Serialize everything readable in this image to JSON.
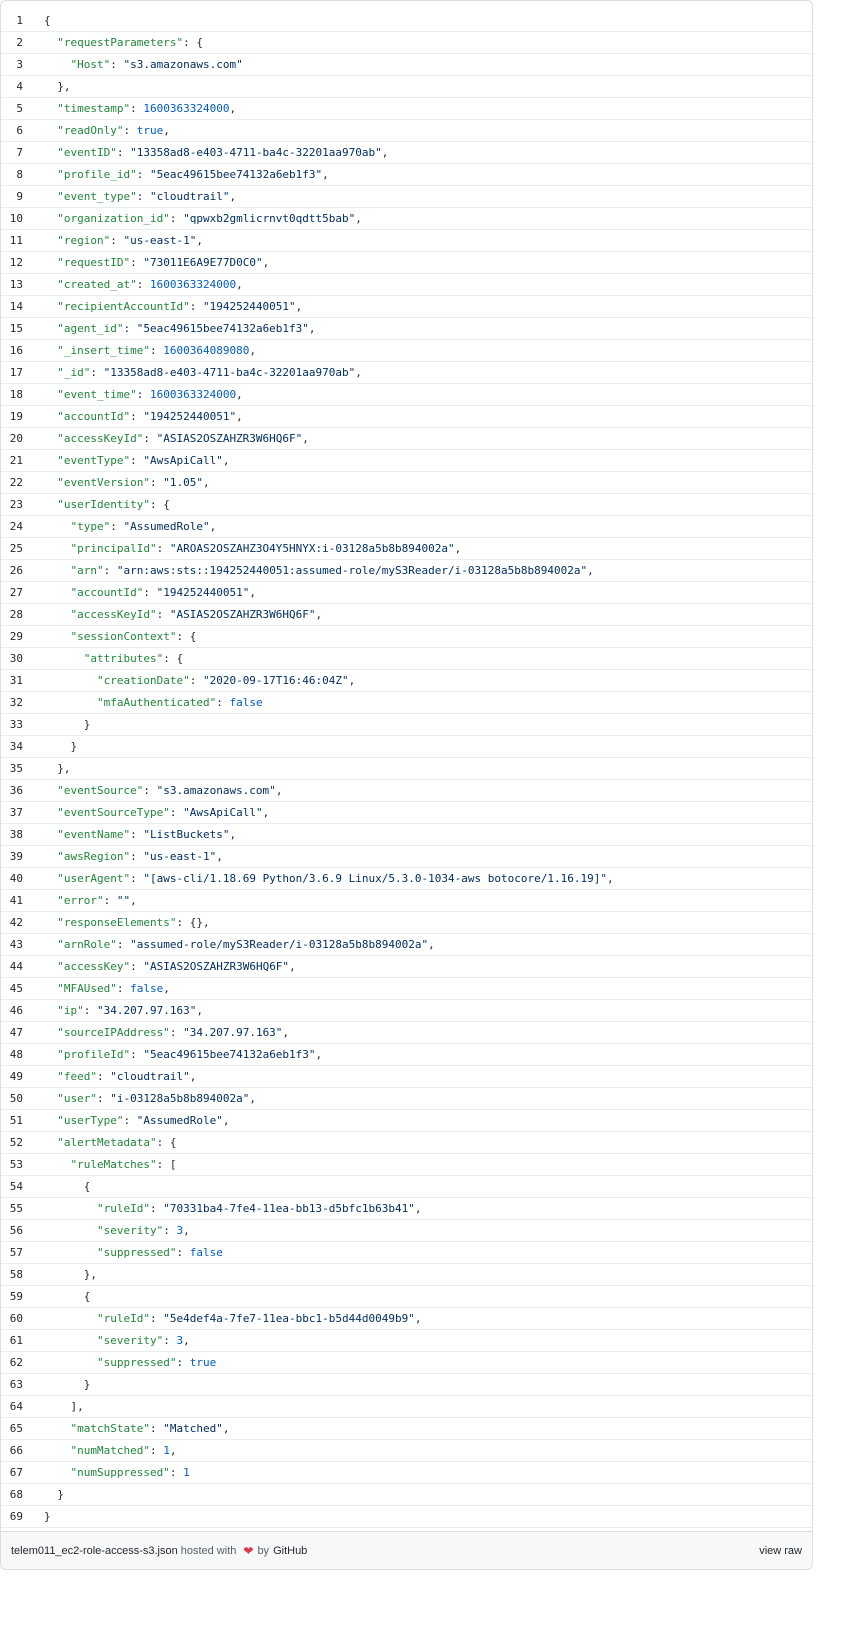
{
  "lines": [
    [
      [
        "p",
        "{"
      ]
    ],
    [
      [
        "p",
        "  "
      ],
      [
        "k",
        "\"requestParameters\""
      ],
      [
        "p",
        ": {"
      ]
    ],
    [
      [
        "p",
        "    "
      ],
      [
        "k",
        "\"Host\""
      ],
      [
        "p",
        ": "
      ],
      [
        "s",
        "\"s3.amazonaws.com\""
      ]
    ],
    [
      [
        "p",
        "  },"
      ]
    ],
    [
      [
        "p",
        "  "
      ],
      [
        "k",
        "\"timestamp\""
      ],
      [
        "p",
        ": "
      ],
      [
        "c",
        "1600363324000"
      ],
      [
        "p",
        ","
      ]
    ],
    [
      [
        "p",
        "  "
      ],
      [
        "k",
        "\"readOnly\""
      ],
      [
        "p",
        ": "
      ],
      [
        "c",
        "true"
      ],
      [
        "p",
        ","
      ]
    ],
    [
      [
        "p",
        "  "
      ],
      [
        "k",
        "\"eventID\""
      ],
      [
        "p",
        ": "
      ],
      [
        "s",
        "\"13358ad8-e403-4711-ba4c-32201aa970ab\""
      ],
      [
        "p",
        ","
      ]
    ],
    [
      [
        "p",
        "  "
      ],
      [
        "k",
        "\"profile_id\""
      ],
      [
        "p",
        ": "
      ],
      [
        "s",
        "\"5eac49615bee74132a6eb1f3\""
      ],
      [
        "p",
        ","
      ]
    ],
    [
      [
        "p",
        "  "
      ],
      [
        "k",
        "\"event_type\""
      ],
      [
        "p",
        ": "
      ],
      [
        "s",
        "\"cloudtrail\""
      ],
      [
        "p",
        ","
      ]
    ],
    [
      [
        "p",
        "  "
      ],
      [
        "k",
        "\"organization_id\""
      ],
      [
        "p",
        ": "
      ],
      [
        "s",
        "\"qpwxb2gmlicrnvt0qdtt5bab\""
      ],
      [
        "p",
        ","
      ]
    ],
    [
      [
        "p",
        "  "
      ],
      [
        "k",
        "\"region\""
      ],
      [
        "p",
        ": "
      ],
      [
        "s",
        "\"us-east-1\""
      ],
      [
        "p",
        ","
      ]
    ],
    [
      [
        "p",
        "  "
      ],
      [
        "k",
        "\"requestID\""
      ],
      [
        "p",
        ": "
      ],
      [
        "s",
        "\"73011E6A9E77D0C0\""
      ],
      [
        "p",
        ","
      ]
    ],
    [
      [
        "p",
        "  "
      ],
      [
        "k",
        "\"created_at\""
      ],
      [
        "p",
        ": "
      ],
      [
        "c",
        "1600363324000"
      ],
      [
        "p",
        ","
      ]
    ],
    [
      [
        "p",
        "  "
      ],
      [
        "k",
        "\"recipientAccountId\""
      ],
      [
        "p",
        ": "
      ],
      [
        "s",
        "\"194252440051\""
      ],
      [
        "p",
        ","
      ]
    ],
    [
      [
        "p",
        "  "
      ],
      [
        "k",
        "\"agent_id\""
      ],
      [
        "p",
        ": "
      ],
      [
        "s",
        "\"5eac49615bee74132a6eb1f3\""
      ],
      [
        "p",
        ","
      ]
    ],
    [
      [
        "p",
        "  "
      ],
      [
        "k",
        "\"_insert_time\""
      ],
      [
        "p",
        ": "
      ],
      [
        "c",
        "1600364089080"
      ],
      [
        "p",
        ","
      ]
    ],
    [
      [
        "p",
        "  "
      ],
      [
        "k",
        "\"_id\""
      ],
      [
        "p",
        ": "
      ],
      [
        "s",
        "\"13358ad8-e403-4711-ba4c-32201aa970ab\""
      ],
      [
        "p",
        ","
      ]
    ],
    [
      [
        "p",
        "  "
      ],
      [
        "k",
        "\"event_time\""
      ],
      [
        "p",
        ": "
      ],
      [
        "c",
        "1600363324000"
      ],
      [
        "p",
        ","
      ]
    ],
    [
      [
        "p",
        "  "
      ],
      [
        "k",
        "\"accountId\""
      ],
      [
        "p",
        ": "
      ],
      [
        "s",
        "\"194252440051\""
      ],
      [
        "p",
        ","
      ]
    ],
    [
      [
        "p",
        "  "
      ],
      [
        "k",
        "\"accessKeyId\""
      ],
      [
        "p",
        ": "
      ],
      [
        "s",
        "\"ASIAS2OSZAHZR3W6HQ6F\""
      ],
      [
        "p",
        ","
      ]
    ],
    [
      [
        "p",
        "  "
      ],
      [
        "k",
        "\"eventType\""
      ],
      [
        "p",
        ": "
      ],
      [
        "s",
        "\"AwsApiCall\""
      ],
      [
        "p",
        ","
      ]
    ],
    [
      [
        "p",
        "  "
      ],
      [
        "k",
        "\"eventVersion\""
      ],
      [
        "p",
        ": "
      ],
      [
        "s",
        "\"1.05\""
      ],
      [
        "p",
        ","
      ]
    ],
    [
      [
        "p",
        "  "
      ],
      [
        "k",
        "\"userIdentity\""
      ],
      [
        "p",
        ": {"
      ]
    ],
    [
      [
        "p",
        "    "
      ],
      [
        "k",
        "\"type\""
      ],
      [
        "p",
        ": "
      ],
      [
        "s",
        "\"AssumedRole\""
      ],
      [
        "p",
        ","
      ]
    ],
    [
      [
        "p",
        "    "
      ],
      [
        "k",
        "\"principalId\""
      ],
      [
        "p",
        ": "
      ],
      [
        "s",
        "\"AROAS2OSZAHZ3O4Y5HNYX:i-03128a5b8b894002a\""
      ],
      [
        "p",
        ","
      ]
    ],
    [
      [
        "p",
        "    "
      ],
      [
        "k",
        "\"arn\""
      ],
      [
        "p",
        ": "
      ],
      [
        "s",
        "\"arn:aws:sts::194252440051:assumed-role/myS3Reader/i-03128a5b8b894002a\""
      ],
      [
        "p",
        ","
      ]
    ],
    [
      [
        "p",
        "    "
      ],
      [
        "k",
        "\"accountId\""
      ],
      [
        "p",
        ": "
      ],
      [
        "s",
        "\"194252440051\""
      ],
      [
        "p",
        ","
      ]
    ],
    [
      [
        "p",
        "    "
      ],
      [
        "k",
        "\"accessKeyId\""
      ],
      [
        "p",
        ": "
      ],
      [
        "s",
        "\"ASIAS2OSZAHZR3W6HQ6F\""
      ],
      [
        "p",
        ","
      ]
    ],
    [
      [
        "p",
        "    "
      ],
      [
        "k",
        "\"sessionContext\""
      ],
      [
        "p",
        ": {"
      ]
    ],
    [
      [
        "p",
        "      "
      ],
      [
        "k",
        "\"attributes\""
      ],
      [
        "p",
        ": {"
      ]
    ],
    [
      [
        "p",
        "        "
      ],
      [
        "k",
        "\"creationDate\""
      ],
      [
        "p",
        ": "
      ],
      [
        "s",
        "\"2020-09-17T16:46:04Z\""
      ],
      [
        "p",
        ","
      ]
    ],
    [
      [
        "p",
        "        "
      ],
      [
        "k",
        "\"mfaAuthenticated\""
      ],
      [
        "p",
        ": "
      ],
      [
        "c",
        "false"
      ]
    ],
    [
      [
        "p",
        "      }"
      ]
    ],
    [
      [
        "p",
        "    }"
      ]
    ],
    [
      [
        "p",
        "  },"
      ]
    ],
    [
      [
        "p",
        "  "
      ],
      [
        "k",
        "\"eventSource\""
      ],
      [
        "p",
        ": "
      ],
      [
        "s",
        "\"s3.amazonaws.com\""
      ],
      [
        "p",
        ","
      ]
    ],
    [
      [
        "p",
        "  "
      ],
      [
        "k",
        "\"eventSourceType\""
      ],
      [
        "p",
        ": "
      ],
      [
        "s",
        "\"AwsApiCall\""
      ],
      [
        "p",
        ","
      ]
    ],
    [
      [
        "p",
        "  "
      ],
      [
        "k",
        "\"eventName\""
      ],
      [
        "p",
        ": "
      ],
      [
        "s",
        "\"ListBuckets\""
      ],
      [
        "p",
        ","
      ]
    ],
    [
      [
        "p",
        "  "
      ],
      [
        "k",
        "\"awsRegion\""
      ],
      [
        "p",
        ": "
      ],
      [
        "s",
        "\"us-east-1\""
      ],
      [
        "p",
        ","
      ]
    ],
    [
      [
        "p",
        "  "
      ],
      [
        "k",
        "\"userAgent\""
      ],
      [
        "p",
        ": "
      ],
      [
        "s",
        "\"[aws-cli/1.18.69 Python/3.6.9 Linux/5.3.0-1034-aws botocore/1.16.19]\""
      ],
      [
        "p",
        ","
      ]
    ],
    [
      [
        "p",
        "  "
      ],
      [
        "k",
        "\"error\""
      ],
      [
        "p",
        ": "
      ],
      [
        "s",
        "\"\""
      ],
      [
        "p",
        ","
      ]
    ],
    [
      [
        "p",
        "  "
      ],
      [
        "k",
        "\"responseElements\""
      ],
      [
        "p",
        ": {},"
      ]
    ],
    [
      [
        "p",
        "  "
      ],
      [
        "k",
        "\"arnRole\""
      ],
      [
        "p",
        ": "
      ],
      [
        "s",
        "\"assumed-role/myS3Reader/i-03128a5b8b894002a\""
      ],
      [
        "p",
        ","
      ]
    ],
    [
      [
        "p",
        "  "
      ],
      [
        "k",
        "\"accessKey\""
      ],
      [
        "p",
        ": "
      ],
      [
        "s",
        "\"ASIAS2OSZAHZR3W6HQ6F\""
      ],
      [
        "p",
        ","
      ]
    ],
    [
      [
        "p",
        "  "
      ],
      [
        "k",
        "\"MFAUsed\""
      ],
      [
        "p",
        ": "
      ],
      [
        "c",
        "false"
      ],
      [
        "p",
        ","
      ]
    ],
    [
      [
        "p",
        "  "
      ],
      [
        "k",
        "\"ip\""
      ],
      [
        "p",
        ": "
      ],
      [
        "s",
        "\"34.207.97.163\""
      ],
      [
        "p",
        ","
      ]
    ],
    [
      [
        "p",
        "  "
      ],
      [
        "k",
        "\"sourceIPAddress\""
      ],
      [
        "p",
        ": "
      ],
      [
        "s",
        "\"34.207.97.163\""
      ],
      [
        "p",
        ","
      ]
    ],
    [
      [
        "p",
        "  "
      ],
      [
        "k",
        "\"profileId\""
      ],
      [
        "p",
        ": "
      ],
      [
        "s",
        "\"5eac49615bee74132a6eb1f3\""
      ],
      [
        "p",
        ","
      ]
    ],
    [
      [
        "p",
        "  "
      ],
      [
        "k",
        "\"feed\""
      ],
      [
        "p",
        ": "
      ],
      [
        "s",
        "\"cloudtrail\""
      ],
      [
        "p",
        ","
      ]
    ],
    [
      [
        "p",
        "  "
      ],
      [
        "k",
        "\"user\""
      ],
      [
        "p",
        ": "
      ],
      [
        "s",
        "\"i-03128a5b8b894002a\""
      ],
      [
        "p",
        ","
      ]
    ],
    [
      [
        "p",
        "  "
      ],
      [
        "k",
        "\"userType\""
      ],
      [
        "p",
        ": "
      ],
      [
        "s",
        "\"AssumedRole\""
      ],
      [
        "p",
        ","
      ]
    ],
    [
      [
        "p",
        "  "
      ],
      [
        "k",
        "\"alertMetadata\""
      ],
      [
        "p",
        ": {"
      ]
    ],
    [
      [
        "p",
        "    "
      ],
      [
        "k",
        "\"ruleMatches\""
      ],
      [
        "p",
        ": ["
      ]
    ],
    [
      [
        "p",
        "      {"
      ]
    ],
    [
      [
        "p",
        "        "
      ],
      [
        "k",
        "\"ruleId\""
      ],
      [
        "p",
        ": "
      ],
      [
        "s",
        "\"70331ba4-7fe4-11ea-bb13-d5bfc1b63b41\""
      ],
      [
        "p",
        ","
      ]
    ],
    [
      [
        "p",
        "        "
      ],
      [
        "k",
        "\"severity\""
      ],
      [
        "p",
        ": "
      ],
      [
        "c",
        "3"
      ],
      [
        "p",
        ","
      ]
    ],
    [
      [
        "p",
        "        "
      ],
      [
        "k",
        "\"suppressed\""
      ],
      [
        "p",
        ": "
      ],
      [
        "c",
        "false"
      ]
    ],
    [
      [
        "p",
        "      },"
      ]
    ],
    [
      [
        "p",
        "      {"
      ]
    ],
    [
      [
        "p",
        "        "
      ],
      [
        "k",
        "\"ruleId\""
      ],
      [
        "p",
        ": "
      ],
      [
        "s",
        "\"5e4def4a-7fe7-11ea-bbc1-b5d44d0049b9\""
      ],
      [
        "p",
        ","
      ]
    ],
    [
      [
        "p",
        "        "
      ],
      [
        "k",
        "\"severity\""
      ],
      [
        "p",
        ": "
      ],
      [
        "c",
        "3"
      ],
      [
        "p",
        ","
      ]
    ],
    [
      [
        "p",
        "        "
      ],
      [
        "k",
        "\"suppressed\""
      ],
      [
        "p",
        ": "
      ],
      [
        "c",
        "true"
      ]
    ],
    [
      [
        "p",
        "      }"
      ]
    ],
    [
      [
        "p",
        "    ],"
      ]
    ],
    [
      [
        "p",
        "    "
      ],
      [
        "k",
        "\"matchState\""
      ],
      [
        "p",
        ": "
      ],
      [
        "s",
        "\"Matched\""
      ],
      [
        "p",
        ","
      ]
    ],
    [
      [
        "p",
        "    "
      ],
      [
        "k",
        "\"numMatched\""
      ],
      [
        "p",
        ": "
      ],
      [
        "c",
        "1"
      ],
      [
        "p",
        ","
      ]
    ],
    [
      [
        "p",
        "    "
      ],
      [
        "k",
        "\"numSuppressed\""
      ],
      [
        "p",
        ": "
      ],
      [
        "c",
        "1"
      ]
    ],
    [
      [
        "p",
        "  }"
      ]
    ],
    [
      [
        "p",
        "}"
      ]
    ]
  ],
  "footer": {
    "filename": "telem011_ec2-role-access-s3.json",
    "hosted_with": "hosted with",
    "heart": "❤",
    "by": "by",
    "github": "GitHub",
    "view_raw": "view raw"
  },
  "colors": {
    "key": "#22863a",
    "string": "#032f62",
    "constant": "#005cc5",
    "heart": "#d73a49"
  }
}
